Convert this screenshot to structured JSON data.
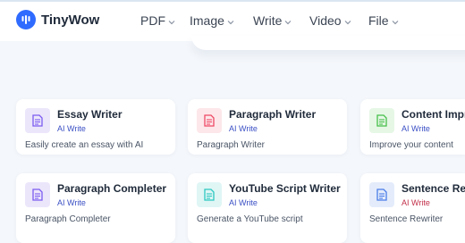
{
  "brand": {
    "name": "TinyWow"
  },
  "nav": [
    {
      "label": "PDF"
    },
    {
      "label": "Image"
    },
    {
      "label": "Write"
    },
    {
      "label": "Video"
    },
    {
      "label": "File"
    }
  ],
  "cards": [
    {
      "title": "Essay Writer",
      "tag": "AI Write",
      "desc": "Easily create an essay with AI",
      "icon": "document-icon",
      "color": "#7b5cf0"
    },
    {
      "title": "Paragraph Writer",
      "tag": "AI Write",
      "desc": "Paragraph Writer",
      "icon": "document-icon",
      "color": "#ef4a66"
    },
    {
      "title": "Content Improver",
      "tag": "AI Write",
      "desc": "Improve your content",
      "icon": "document-icon",
      "color": "#47c04a"
    },
    {
      "title": "Paragraph Completer",
      "tag": "AI Write",
      "desc": "Paragraph Completer",
      "icon": "document-icon",
      "color": "#7b5cf0"
    },
    {
      "title": "YouTube Script Writer",
      "tag": "AI Write",
      "desc": "Generate a YouTube script",
      "icon": "document-icon",
      "color": "#2cc8c0"
    },
    {
      "title": "Sentence Rewriter",
      "tag": "AI Write",
      "desc": "Sentence Rewriter",
      "icon": "document-icon",
      "color": "#4a7de8"
    }
  ],
  "colors": {
    "brand_blue": "#2f6bff",
    "tag_text": "#3a4fc4",
    "background": "#f4f7fb"
  }
}
